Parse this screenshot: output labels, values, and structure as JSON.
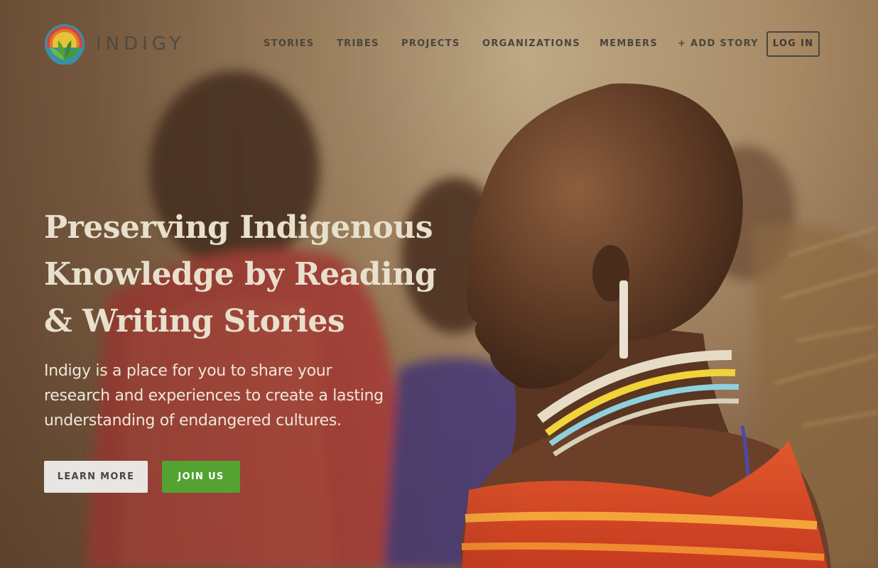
{
  "brand": {
    "name": "INDIGY",
    "colors": {
      "green": "#53a232",
      "ring_yellow": "#e8c23a",
      "ring_orange": "#e07a30",
      "ring_red": "#d6443a",
      "text": "#4e4a42"
    }
  },
  "nav": {
    "items": [
      {
        "label": "STORIES"
      },
      {
        "label": "TRIBES"
      },
      {
        "label": "PROJECTS"
      },
      {
        "label": "ORGANIZATIONS"
      },
      {
        "label": "MEMBERS"
      },
      {
        "label": "+ ADD STORY"
      }
    ],
    "login_label": "LOG IN"
  },
  "hero": {
    "headline": "Preserving Indigenous Knowledge by Reading & Writing Stories",
    "subtext": "Indigy is a place for you to share your research and experiences to create a lasting understanding of endangered cultures.",
    "learn_more_label": "LEARN MORE",
    "join_label": "JOIN US",
    "colors": {
      "headline": "#e8e0cc",
      "join_button": "#53a232",
      "learn_button": "#e7e6e2"
    }
  }
}
